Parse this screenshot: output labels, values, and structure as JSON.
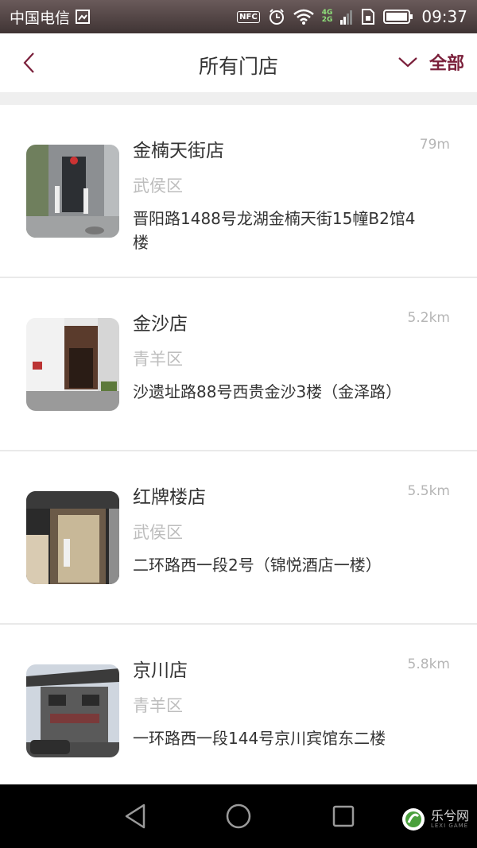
{
  "status_bar": {
    "carrier": "中国电信",
    "nfc": "NFC",
    "net_4g": "4G",
    "net_2g": "2G",
    "time": "09:37"
  },
  "header": {
    "title": "所有门店",
    "filter_label": "全部"
  },
  "stores": [
    {
      "name": "金楠天街店",
      "distance": "79m",
      "district": "武侯区",
      "address": "晋阳路1488号龙湖金楠天街15幢B2馆4楼"
    },
    {
      "name": "金沙店",
      "distance": "5.2km",
      "district": "青羊区",
      "address": "沙遗址路88号西贵金沙3楼（金泽路）"
    },
    {
      "name": "红牌楼店",
      "distance": "5.5km",
      "district": "武侯区",
      "address": "二环路西一段2号（锦悦酒店一楼）"
    },
    {
      "name": "京川店",
      "distance": "5.8km",
      "district": "青羊区",
      "address": "一环路西一段144号京川宾馆东二楼"
    }
  ],
  "watermark": {
    "text": "乐兮网",
    "sub": "LEXI GAME"
  },
  "colors": {
    "accent": "#7a1f3a",
    "status_bar": "#4a3d3d"
  }
}
